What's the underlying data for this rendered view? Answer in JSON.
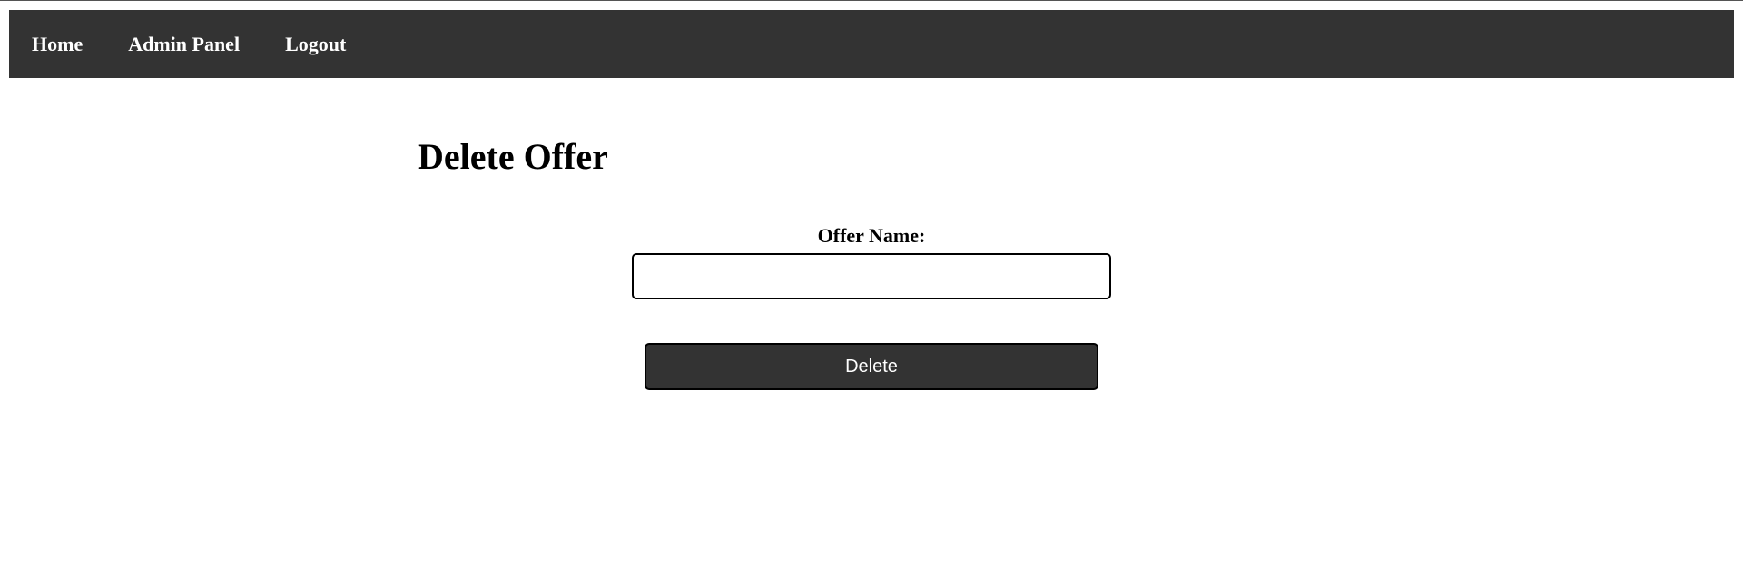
{
  "nav": {
    "items": [
      {
        "label": "Home"
      },
      {
        "label": "Admin Panel"
      },
      {
        "label": "Logout"
      }
    ]
  },
  "main": {
    "title": "Delete Offer",
    "form": {
      "offer_name_label": "Offer Name:",
      "offer_name_value": "",
      "offer_name_placeholder": "",
      "submit_label": "Delete"
    }
  },
  "colors": {
    "navbar_bg": "#333333",
    "nav_text": "#ffffff",
    "button_bg": "#333333",
    "button_text": "#ffffff"
  }
}
